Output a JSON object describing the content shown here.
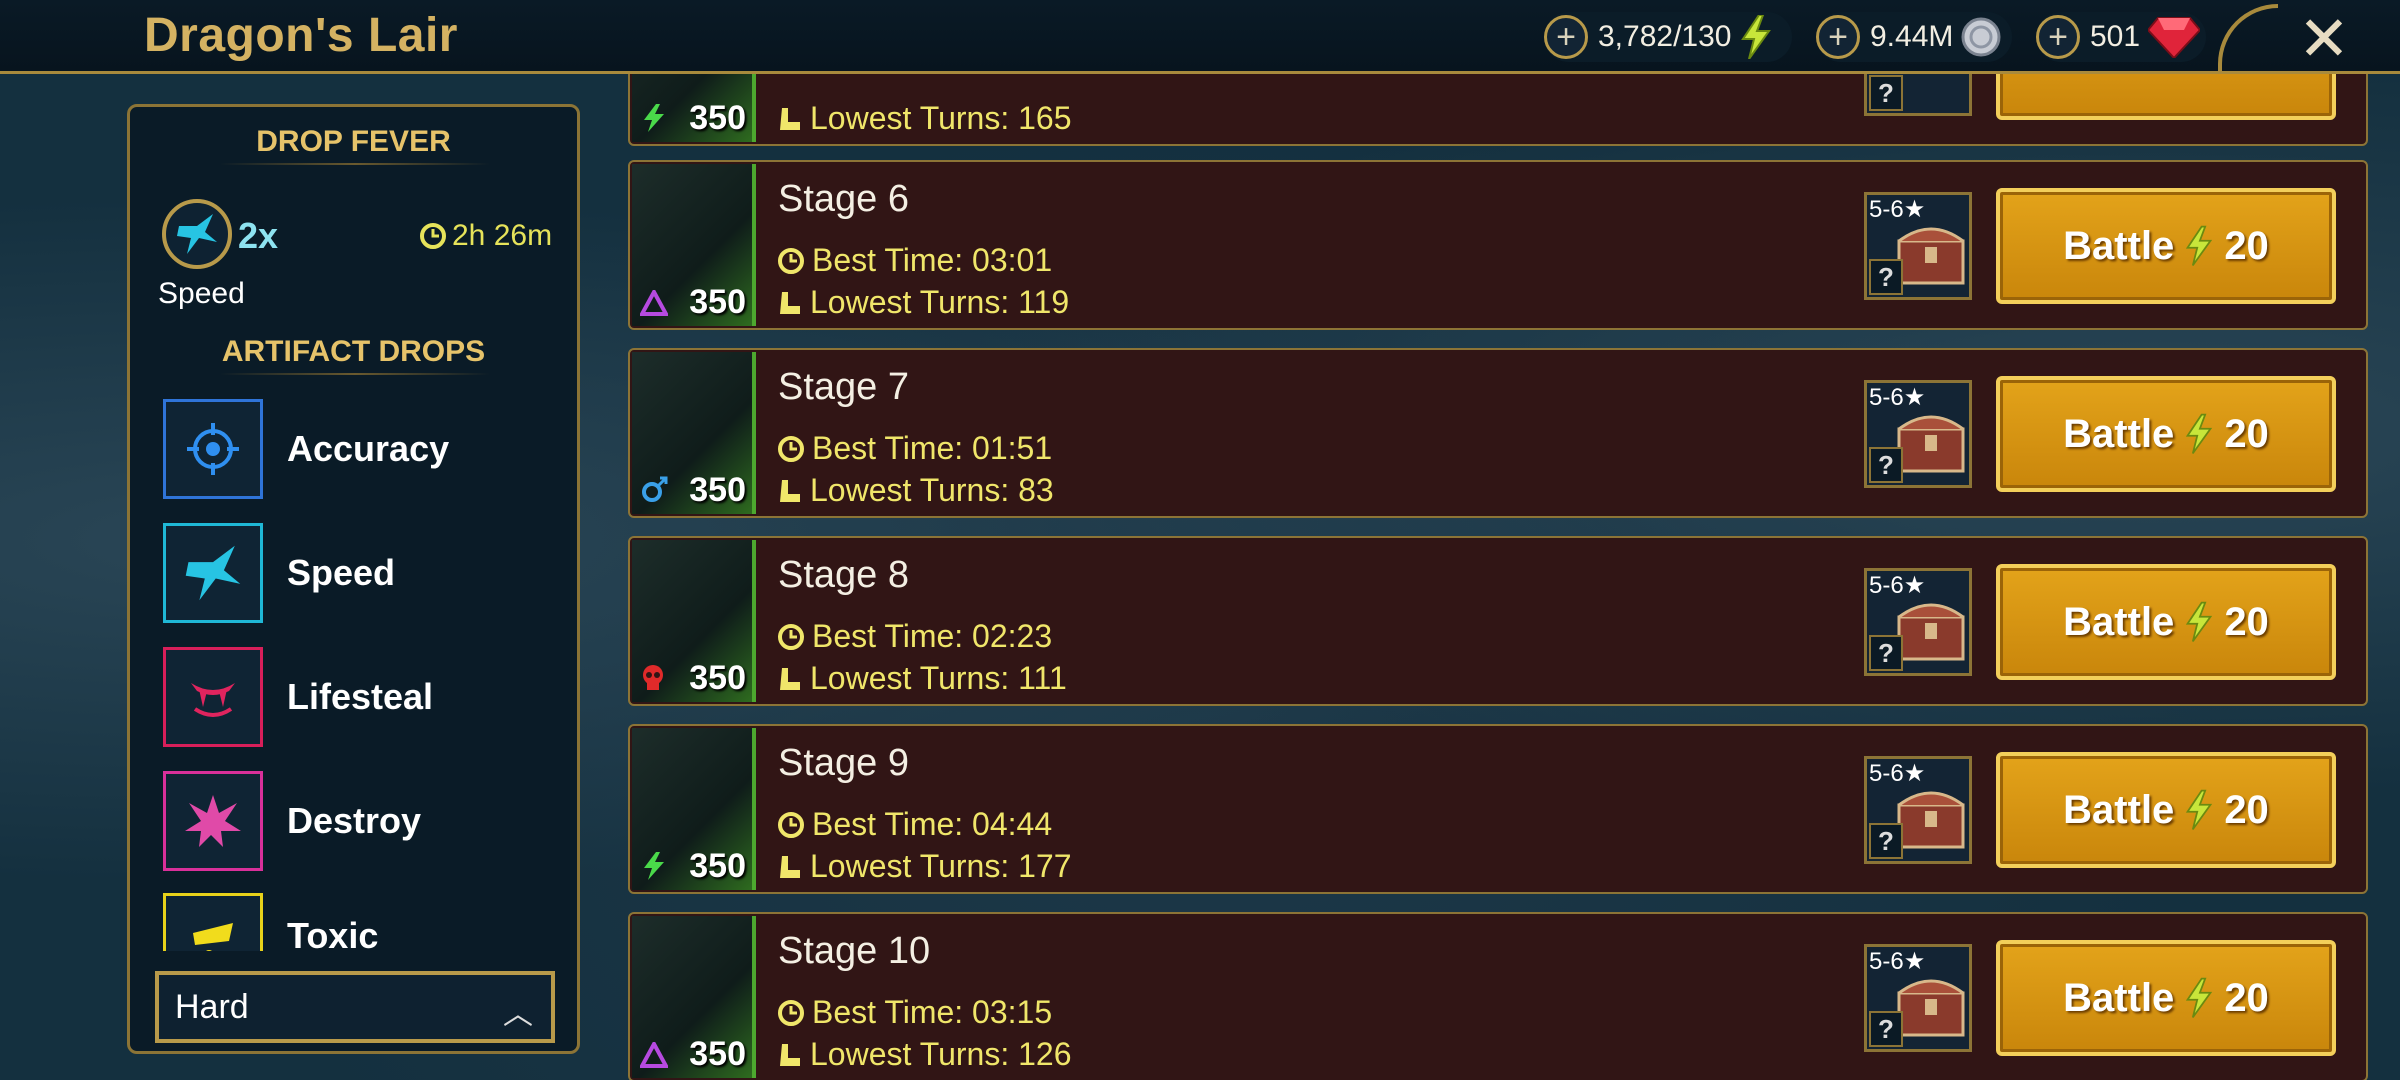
{
  "header": {
    "title": "Dragon's Lair",
    "energy": "3,782/130",
    "silver": "9.44M",
    "gems": "501"
  },
  "sidebar": {
    "drop_fever_title": "DROP FEVER",
    "fever_multiplier": "2x",
    "fever_timer": "2h 26m",
    "fever_stat": "Speed",
    "artifact_drops_title": "ARTIFACT DROPS",
    "artifacts": [
      {
        "label": "Accuracy",
        "color": "#2f74d8"
      },
      {
        "label": "Speed",
        "color": "#1fb8d6"
      },
      {
        "label": "Lifesteal",
        "color": "#d81f5a"
      },
      {
        "label": "Destroy",
        "color": "#d9309a"
      },
      {
        "label": "Toxic",
        "color": "#e8d21a"
      }
    ],
    "difficulty": "Hard"
  },
  "stages": [
    {
      "name": "",
      "best_time": "",
      "lowest_turns": "Lowest Turns: 165",
      "hp": "350",
      "affinity": "force"
    },
    {
      "name": "Stage 6",
      "best_time": "Best Time: 03:01",
      "lowest_turns": "Lowest Turns: 119",
      "hp": "350",
      "affinity": "magic"
    },
    {
      "name": "Stage 7",
      "best_time": "Best Time: 01:51",
      "lowest_turns": "Lowest Turns: 83",
      "hp": "350",
      "affinity": "spirit"
    },
    {
      "name": "Stage 8",
      "best_time": "Best Time: 02:23",
      "lowest_turns": "Lowest Turns: 111",
      "hp": "350",
      "affinity": "void"
    },
    {
      "name": "Stage 9",
      "best_time": "Best Time: 04:44",
      "lowest_turns": "Lowest Turns: 177",
      "hp": "350",
      "affinity": "force"
    },
    {
      "name": "Stage 10",
      "best_time": "Best Time: 03:15",
      "lowest_turns": "Lowest Turns: 126",
      "hp": "350",
      "affinity": "magic"
    }
  ],
  "chest": {
    "rank": "5-6",
    "unknown": "?"
  },
  "battle": {
    "label": "Battle",
    "cost": "20"
  },
  "colors": {
    "gold": "#d4b262",
    "energy": "#e6e35a",
    "battle_button": "#d6920f",
    "stage_bg": "#311515"
  }
}
